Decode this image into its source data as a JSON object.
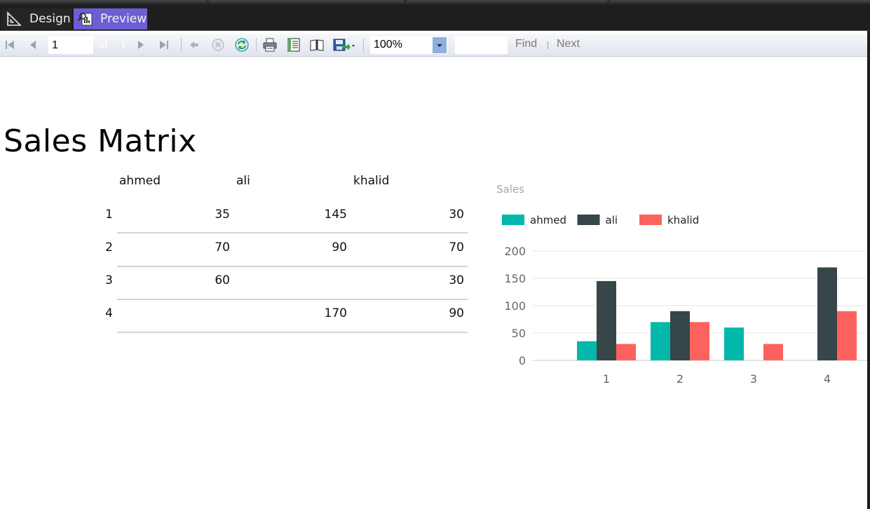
{
  "tabs": [
    {
      "label": "Design"
    },
    {
      "label": "Preview"
    }
  ],
  "toolbar": {
    "page_value": "1",
    "of_label": "of",
    "total_pages": "1",
    "zoom": "100%",
    "find_label": "Find",
    "next_label": "Next"
  },
  "report": {
    "title": "Sales Matrix",
    "matrix": {
      "columns": [
        "ahmed",
        "ali",
        "khalid"
      ],
      "rows": [
        {
          "label": "1",
          "values": [
            "35",
            "145",
            "30"
          ]
        },
        {
          "label": "2",
          "values": [
            "70",
            "90",
            "70"
          ]
        },
        {
          "label": "3",
          "values": [
            "60",
            "",
            "30"
          ]
        },
        {
          "label": "4",
          "values": [
            "",
            "170",
            "90"
          ]
        }
      ]
    }
  },
  "chart_data": {
    "type": "bar",
    "title": "Sales",
    "categories": [
      "1",
      "2",
      "3",
      "4"
    ],
    "series": [
      {
        "name": "ahmed",
        "color": "#01b8aa",
        "values": [
          35,
          70,
          60,
          null
        ]
      },
      {
        "name": "ali",
        "color": "#374649",
        "values": [
          145,
          90,
          null,
          170
        ]
      },
      {
        "name": "khalid",
        "color": "#fd625e",
        "values": [
          30,
          70,
          30,
          90
        ]
      }
    ],
    "ylim": [
      0,
      200
    ],
    "yticks": [
      "0",
      "50",
      "100",
      "150",
      "200"
    ],
    "grid": true,
    "legend": "top-left"
  }
}
